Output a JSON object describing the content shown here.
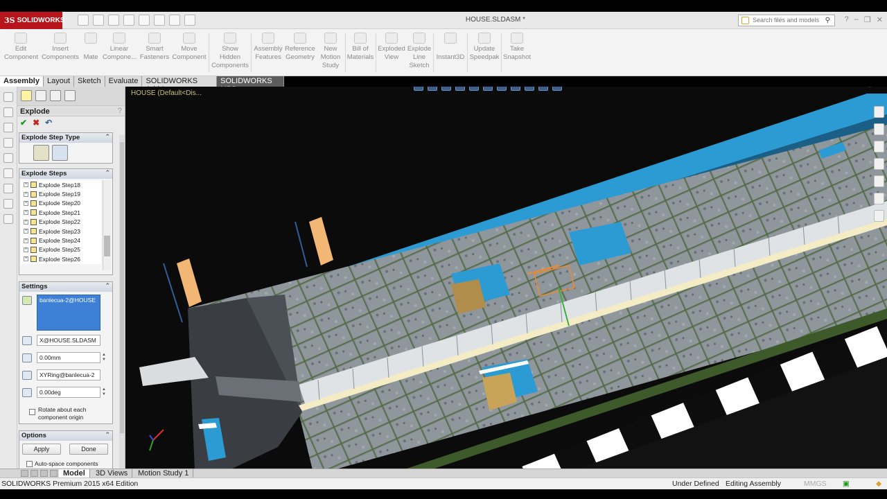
{
  "app": {
    "brand": "SOLIDWORKS",
    "ds": "3S",
    "document_title": "HOUSE.SLDASM *",
    "search_placeholder": "Search files and models"
  },
  "ribbon": {
    "edit_component": [
      "Edit",
      "Component"
    ],
    "insert_components": [
      "Insert",
      "Components"
    ],
    "mate": [
      "Mate"
    ],
    "linear_component": [
      "Linear",
      "Compone..."
    ],
    "smart_fasteners": [
      "Smart",
      "Fasteners"
    ],
    "move_component": [
      "Move",
      "Component"
    ],
    "show_hidden": [
      "Show",
      "Hidden",
      "Components"
    ],
    "assembly_features": [
      "Assembly",
      "Features"
    ],
    "reference_geometry": [
      "Reference",
      "Geometry"
    ],
    "new_motion_study": [
      "New",
      "Motion",
      "Study"
    ],
    "bill_of_materials": [
      "Bill of",
      "Materials"
    ],
    "exploded_view": [
      "Exploded",
      "View"
    ],
    "explode_line_sketch": [
      "Explode",
      "Line",
      "Sketch"
    ],
    "instant3d": [
      "Instant3D"
    ],
    "update_speedpak": [
      "Update",
      "Speedpak"
    ],
    "take_snapshot": [
      "Take",
      "Snapshot"
    ]
  },
  "tabs": [
    "Assembly",
    "Layout",
    "Sketch",
    "Evaluate",
    "SOLIDWORKS Add-Ins",
    "SOLIDWORKS MBD"
  ],
  "viewport": {
    "tree_tag": "HOUSE  (Default<Dis..."
  },
  "panel": {
    "title": "Explode",
    "help": "?",
    "step_type_header": "Explode Step Type",
    "steps_header": "Explode Steps",
    "steps": [
      "Explode Step18",
      "Explode Step19",
      "Explode Step20",
      "Explode Step21",
      "Explode Step22",
      "Explode Step23",
      "Explode Step24",
      "Explode Step25",
      "Explode Step26"
    ],
    "settings_header": "Settings",
    "component": "banlecua-2@HOUSE",
    "direction": "X@HOUSE.SLDASM",
    "distance": "0.00mm",
    "rotation_axis": "XYRing@banlecua-2",
    "angle": "0.00deg",
    "rotate_checkbox": "Rotate about each component origin",
    "options_header": "Options",
    "apply": "Apply",
    "done": "Done",
    "auto_space": "Auto-space components"
  },
  "bottom_tabs": [
    "Model",
    "3D Views",
    "Motion Study 1"
  ],
  "status": {
    "edition": "SOLIDWORKS Premium 2015 x64 Edition",
    "defined": "Under Defined",
    "editing": "Editing Assembly",
    "units": "MMGS"
  }
}
